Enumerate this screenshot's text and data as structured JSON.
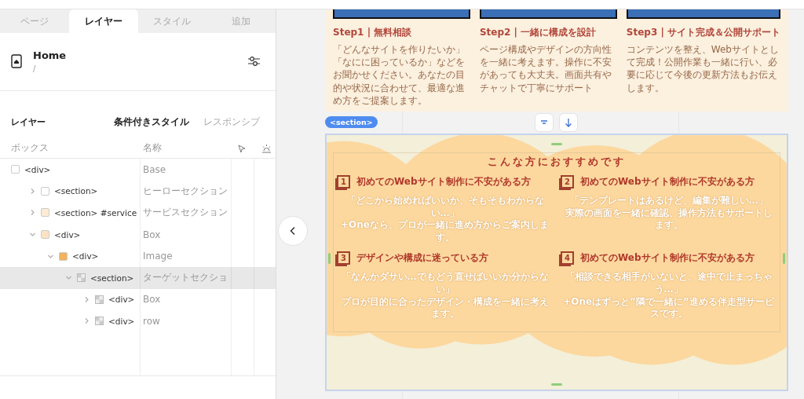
{
  "panel": {
    "tabs": [
      {
        "label": "ページ",
        "selected": false
      },
      {
        "label": "レイヤー",
        "selected": true
      },
      {
        "label": "スタイル",
        "selected": false
      },
      {
        "label": "追加",
        "selected": false
      }
    ],
    "page": {
      "title": "Home",
      "path": "/"
    },
    "layers_heading": "レイヤー",
    "mode_tabs": [
      {
        "label": "条件付きスタイル",
        "selected": true
      },
      {
        "label": "レスポンシブ",
        "selected": false
      }
    ],
    "columns": [
      "ボックス",
      "名称"
    ],
    "tree": [
      {
        "tag": "<div>",
        "name": "Base",
        "kind": "swatch",
        "color": "#ffffff",
        "selected": false,
        "children": [
          {
            "tag": "<section>",
            "name": "ヒーローセクション",
            "kind": "swatch",
            "color": "#ffffff",
            "expanded": false,
            "selected": false
          },
          {
            "tag": "<section> #service",
            "name": "サービスセクション",
            "kind": "swatch",
            "color": "#fdebd3",
            "expanded": false,
            "selected": false
          },
          {
            "tag": "<div>",
            "name": "Box",
            "kind": "swatch",
            "color": "#fde3c4",
            "expanded": true,
            "selected": false,
            "children": [
              {
                "tag": "<div>",
                "name": "Image",
                "kind": "swatch",
                "color": "#f2b25e",
                "expanded": true,
                "selected": false,
                "children": [
                  {
                    "tag": "<section>",
                    "name": "ターゲットセクショ",
                    "kind": "image",
                    "expanded": true,
                    "selected": true,
                    "children": [
                      {
                        "tag": "<div>",
                        "name": "Box",
                        "kind": "image",
                        "expanded": false,
                        "selected": false
                      },
                      {
                        "tag": "<div>",
                        "name": "row",
                        "kind": "image",
                        "expanded": false,
                        "selected": false
                      }
                    ]
                  }
                ]
              }
            ]
          }
        ]
      }
    ]
  },
  "canvas": {
    "steps": [
      {
        "title": "Step1 | 無料相談",
        "body": "「どんなサイトを作りたいか」「なにに困っているか」などをお聞かせください。あなたの目的や状況に合わせて、最適な進め方をご提案します。"
      },
      {
        "title": "Step2 | 一緒に構成を設計",
        "body": "ページ構成やデザインの方向性を一緒に考えます。操作に不安があっても大丈夫。画面共有やチャットで丁寧にサポート"
      },
      {
        "title": "Step3 | サイト完成＆公開サポート",
        "body": "コンテンツを整え、Webサイトとして完成！公開作業も一緒に行い、必要に応じて今後の更新方法もお伝えします。"
      }
    ],
    "section_tag": "<section>",
    "target": {
      "heading": "こんな方におすすめです",
      "items": [
        {
          "number": "1",
          "title": "初めてのWebサイト制作に不安がある方",
          "body": [
            "「どこから始めればいいか、そもそもわからない…」",
            "+Oneなら、プロが一緒に進め方からご案内します。"
          ]
        },
        {
          "number": "2",
          "title": "初めてのWebサイト制作に不安がある方",
          "body": [
            "「テンプレートはあるけど、編集が難しい…」",
            "実際の画面を一緒に確認、操作方法もサポートします。"
          ]
        },
        {
          "number": "3",
          "title": "デザインや構成に迷っている方",
          "body": [
            "「なんかダサい…でもどう直せばいいか分からない」",
            "プロが目的に合ったデザイン・構成を一緒に考えます。"
          ]
        },
        {
          "number": "4",
          "title": "初めてのWebサイト制作に不安がある方",
          "body": [
            "「相談できる相手がいないと、途中で止まっちゃう…」",
            "+Oneはずっと”隣で一緒に”進める伴走型サービスです。"
          ]
        }
      ]
    }
  }
}
